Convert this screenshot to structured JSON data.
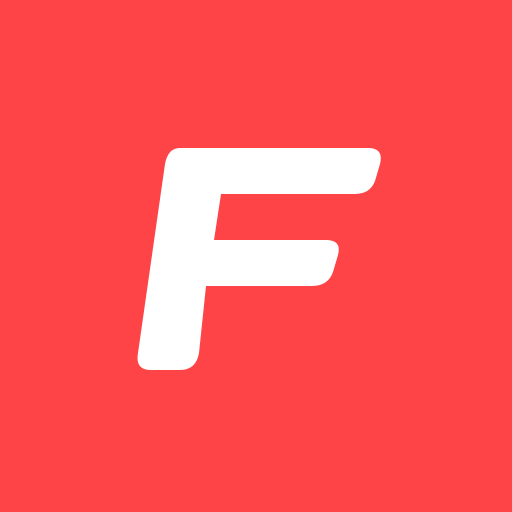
{
  "icon": {
    "name": "app-logo",
    "background_color": "#ff4447",
    "glyph_color": "#ffffff",
    "glyph_text": "F"
  }
}
